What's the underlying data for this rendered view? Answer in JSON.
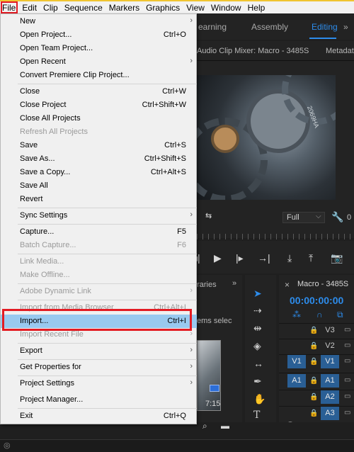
{
  "menubar": [
    "File",
    "Edit",
    "Clip",
    "Sequence",
    "Markers",
    "Graphics",
    "View",
    "Window",
    "Help"
  ],
  "workspaces": {
    "learning": "earning",
    "assembly": "Assembly",
    "editing": "Editing",
    "more": "»"
  },
  "program_monitor": {
    "tab_title": "Audio Clip Mixer: Macro - 3485S",
    "meta_tab": "Metadat",
    "video_overlay_text": "2069HA",
    "fit_value": "Full",
    "zero": "0"
  },
  "project_panel": {
    "tab": "braries",
    "chevron": "»",
    "item_count": "ems selec",
    "thumb_duration": "7:15"
  },
  "timeline": {
    "close": "×",
    "title": "Macro - 3485S",
    "timecode": "00:00:00:00",
    "tracks": [
      {
        "src": "",
        "tgt": "V3"
      },
      {
        "src": "",
        "tgt": "V2"
      },
      {
        "src": "V1",
        "tgt": "V1"
      },
      {
        "src": "A1",
        "tgt": "A1"
      },
      {
        "src": "",
        "tgt": "A2"
      },
      {
        "src": "",
        "tgt": "A3"
      }
    ]
  },
  "file_menu": {
    "new": "New",
    "open_project": "Open Project...",
    "open_project_sc": "Ctrl+O",
    "open_team_project": "Open Team Project...",
    "open_recent": "Open Recent",
    "convert": "Convert Premiere Clip Project...",
    "close": "Close",
    "close_sc": "Ctrl+W",
    "close_project": "Close Project",
    "close_project_sc": "Ctrl+Shift+W",
    "close_all_projects": "Close All Projects",
    "refresh_all_projects": "Refresh All Projects",
    "save": "Save",
    "save_sc": "Ctrl+S",
    "save_as": "Save As...",
    "save_as_sc": "Ctrl+Shift+S",
    "save_copy": "Save a Copy...",
    "save_copy_sc": "Ctrl+Alt+S",
    "save_all": "Save All",
    "revert": "Revert",
    "sync_settings": "Sync Settings",
    "capture": "Capture...",
    "capture_sc": "F5",
    "batch_capture": "Batch Capture...",
    "batch_capture_sc": "F6",
    "link_media": "Link Media...",
    "make_offline": "Make Offline...",
    "adobe_dynamic_link": "Adobe Dynamic Link",
    "import_from_media_browser": "Import from Media Browser",
    "import_from_media_browser_sc": "Ctrl+Alt+I",
    "import": "Import...",
    "import_sc": "Ctrl+I",
    "import_recent": "Import Recent File",
    "export": "Export",
    "get_properties": "Get Properties for",
    "project_settings": "Project Settings",
    "project_manager": "Project Manager...",
    "exit": "Exit",
    "exit_sc": "Ctrl+Q"
  },
  "icons": {
    "submenu": "›",
    "lock": "🔒",
    "film": "▭"
  },
  "colors": {
    "accent_blue": "#2d8ceb",
    "highlight_red": "#e31b23",
    "menu_highlight": "#99c9ef"
  }
}
